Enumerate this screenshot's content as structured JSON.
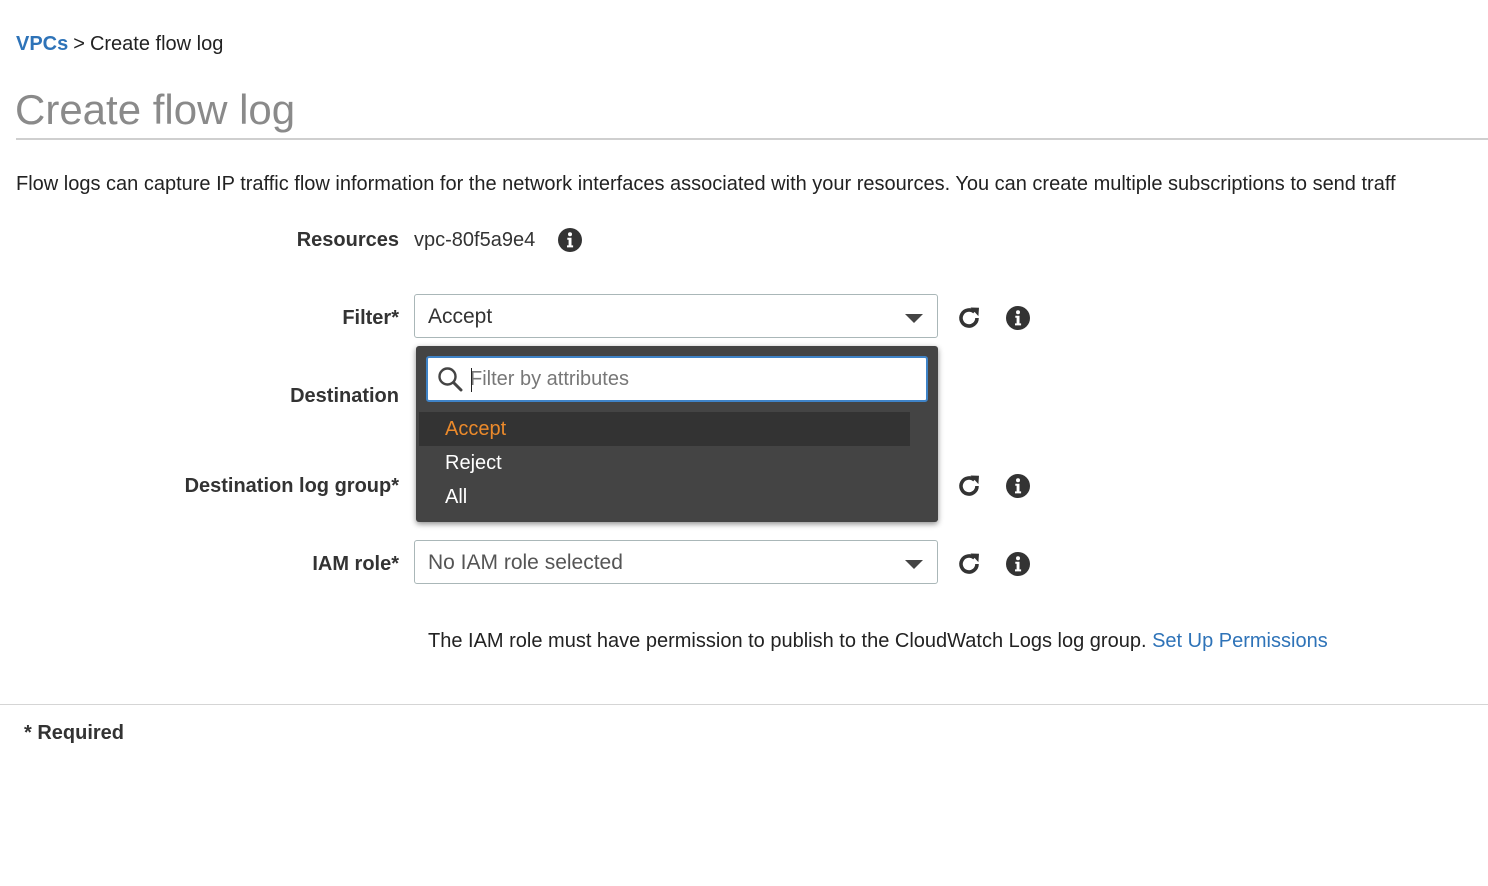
{
  "breadcrumb": {
    "parent": "VPCs",
    "separator": ">",
    "current": "Create flow log"
  },
  "page": {
    "title": "Create flow log",
    "intro": "Flow logs can capture IP traffic flow information for the network interfaces associated with your resources. You can create multiple subscriptions to send traff"
  },
  "form": {
    "resources": {
      "label": "Resources",
      "value": "vpc-80f5a9e4"
    },
    "filter": {
      "label": "Filter*",
      "value": "Accept"
    },
    "destination": {
      "label": "Destination"
    },
    "destination_log_group": {
      "label": "Destination log group*"
    },
    "iam_role": {
      "label": "IAM role*",
      "value": "No IAM role selected"
    }
  },
  "dropdown": {
    "search_placeholder": "Filter by attributes",
    "options": [
      "Accept",
      "Reject",
      "All"
    ],
    "selected": "Accept"
  },
  "helper": {
    "text": "The IAM role must have permission to publish to the CloudWatch Logs log group.",
    "link": "Set Up Permissions"
  },
  "footer": {
    "required_note": "* Required"
  },
  "colors": {
    "link": "#2e73b8",
    "title": "#8a8a8a",
    "dropdown_bg": "#444444",
    "dropdown_selected_bg": "#333333",
    "dropdown_selected_text": "#ec8a2b",
    "search_focus_border": "#3f83c7"
  },
  "icons": {
    "info": "info-circle-icon",
    "refresh": "refresh-icon",
    "caret": "caret-down-icon",
    "search": "magnifier-icon"
  }
}
